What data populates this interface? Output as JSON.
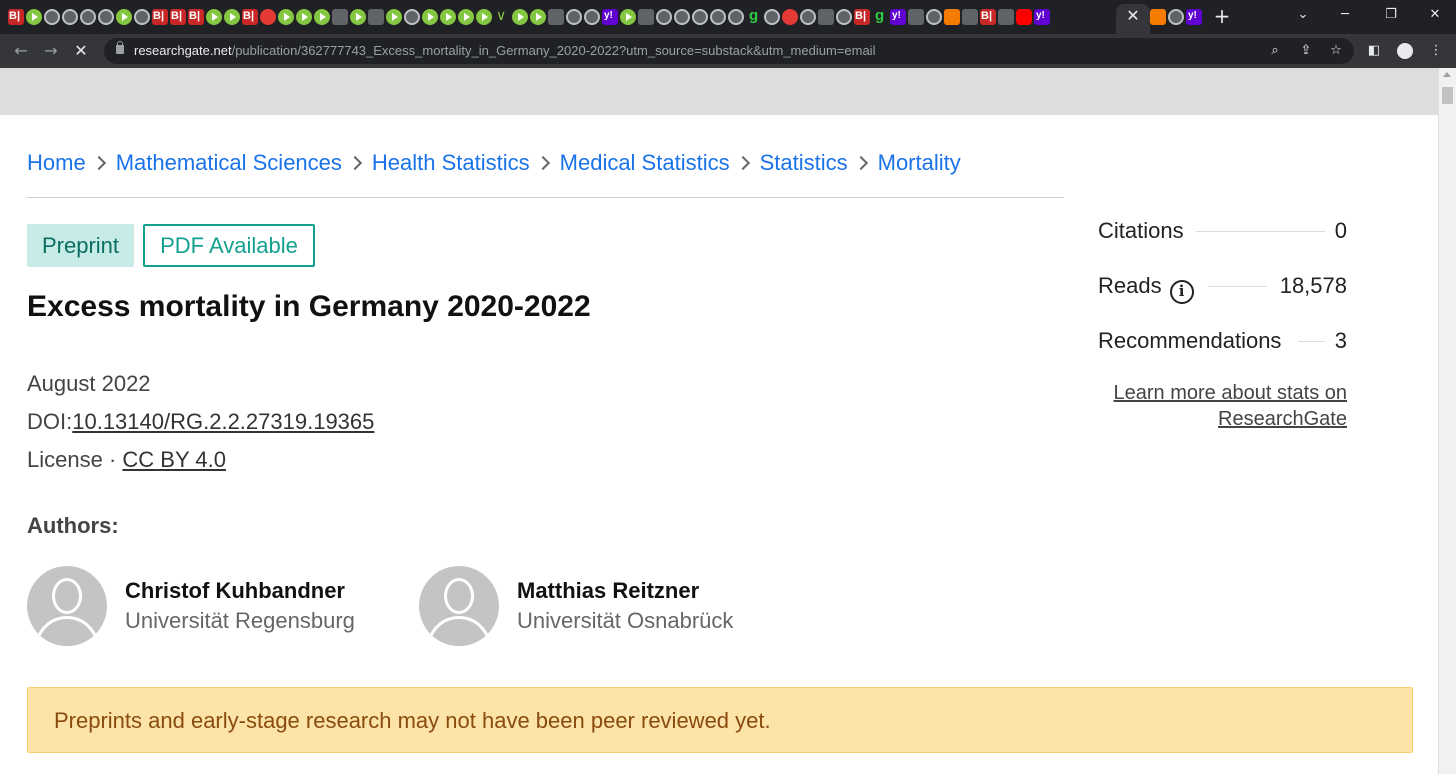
{
  "browser": {
    "url_host": "researchgate.net",
    "url_path": "/publication/362777743_Excess_mortality_in_Germany_2020-2022?utm_source=substack&utm_medium=email",
    "tab_favicons": [
      "bi",
      "rumble",
      "globe",
      "globe",
      "globe",
      "globe",
      "rumble",
      "globe",
      "bi",
      "bi",
      "bi",
      "rumble",
      "rumble",
      "bi",
      "red",
      "rumble",
      "rumble",
      "rumble",
      "grey",
      "rumble",
      "grey",
      "rumble",
      "globe",
      "rumble",
      "rumble",
      "rumble",
      "rumble",
      "v",
      "rumble",
      "rumble",
      "grey",
      "globe",
      "globe",
      "yahoo",
      "rumble",
      "grey",
      "globe",
      "globe",
      "globe",
      "globe",
      "globe",
      "g",
      "globe",
      "red",
      "globe",
      "grey",
      "globe",
      "bi",
      "g",
      "yahoo",
      "grey",
      "globe",
      "orange",
      "grey",
      "bi",
      "grey",
      "yt",
      "yahoo"
    ],
    "active_tab_favicons": [
      "orange",
      "globe",
      "yahoo"
    ]
  },
  "breadcrumb": [
    "Home",
    "Mathematical Sciences",
    "Health Statistics",
    "Medical Statistics",
    "Statistics",
    "Mortality"
  ],
  "badges": {
    "type": "Preprint",
    "pdf": "PDF Available"
  },
  "publication": {
    "title": "Excess mortality in Germany 2020-2022",
    "date": "August 2022",
    "doi_label": "DOI:",
    "doi": "10.13140/RG.2.2.27319.19365",
    "license_label": "License · ",
    "license": "CC BY 4.0"
  },
  "authors_heading": "Authors:",
  "authors": [
    {
      "name": "Christof Kuhbandner",
      "institution": "Universität Regensburg"
    },
    {
      "name": "Matthias Reitzner",
      "institution": "Universität Osnabrück"
    }
  ],
  "stats": {
    "citations_label": "Citations",
    "citations": "0",
    "reads_label": "Reads",
    "reads": "18,578",
    "recommendations_label": "Recommendations",
    "recommendations": "3",
    "learn_more": "Learn more about stats on ResearchGate"
  },
  "warning": "Preprints and early-stage research may not have been peer reviewed yet.",
  "colors": {
    "link": "#1a73e8",
    "teal": "#14a08f",
    "warning_bg": "#fce3a8",
    "warning_text": "#8a4b0e"
  }
}
